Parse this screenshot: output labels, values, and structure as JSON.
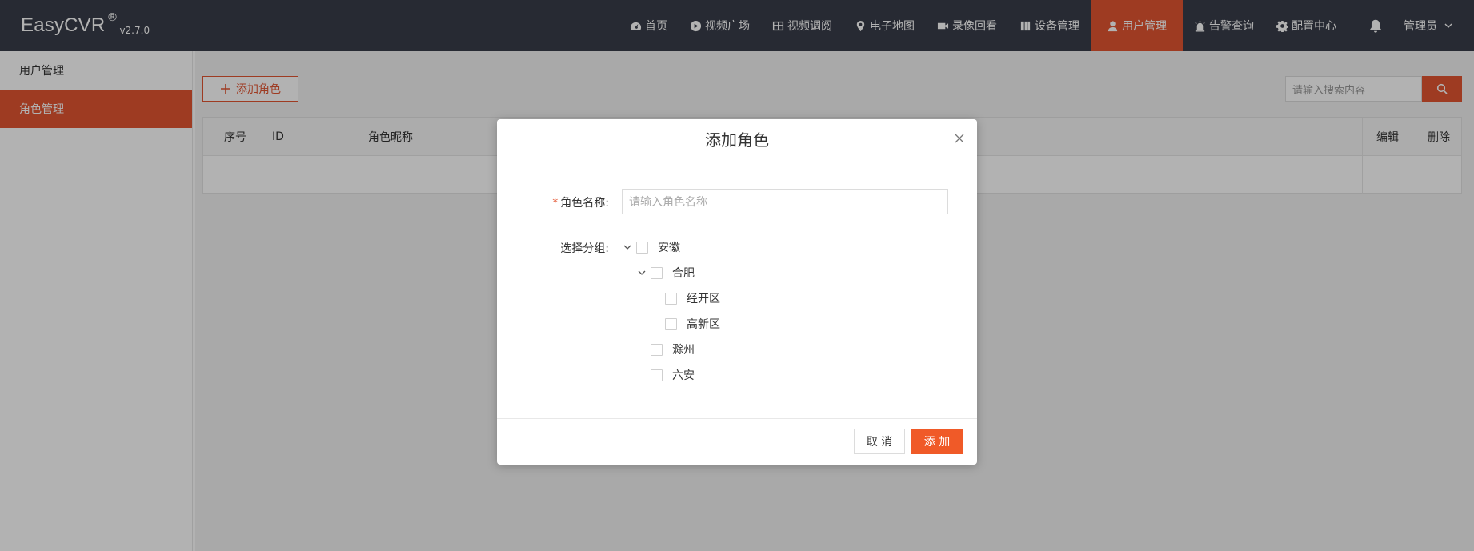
{
  "app": {
    "brand": "EasyCVR",
    "reg": "®",
    "version": "v2.7.0"
  },
  "nav": {
    "items": [
      {
        "label": "首页",
        "icon": "dashboard-icon"
      },
      {
        "label": "视频广场",
        "icon": "play-circle-icon"
      },
      {
        "label": "视频调阅",
        "icon": "grid-icon"
      },
      {
        "label": "电子地图",
        "icon": "map-pin-icon"
      },
      {
        "label": "录像回看",
        "icon": "video-camera-icon"
      },
      {
        "label": "设备管理",
        "icon": "device-icon"
      },
      {
        "label": "用户管理",
        "icon": "user-icon",
        "active": true
      },
      {
        "label": "告警查询",
        "icon": "alarm-icon"
      },
      {
        "label": "配置中心",
        "icon": "gear-icon"
      }
    ],
    "user_label": "管理员"
  },
  "sidebar": {
    "items": [
      {
        "label": "用户管理"
      },
      {
        "label": "角色管理",
        "active": true
      }
    ]
  },
  "main": {
    "add_role_label": "添加角色",
    "search_placeholder": "请输入搜索内容",
    "table": {
      "headers": [
        "序号",
        "ID",
        "角色昵称",
        "编辑",
        "删除"
      ]
    }
  },
  "modal": {
    "title": "添加角色",
    "name_label": "角色名称:",
    "required_mark": "*",
    "name_placeholder": "请输入角色名称",
    "group_label": "选择分组:",
    "tree": [
      {
        "label": "安徽",
        "level": 0,
        "expanded": true
      },
      {
        "label": "合肥",
        "level": 1,
        "expanded": true
      },
      {
        "label": "经开区",
        "level": 2
      },
      {
        "label": "高新区",
        "level": 2
      },
      {
        "label": "滁州",
        "level": 1
      },
      {
        "label": "六安",
        "level": 1
      }
    ],
    "cancel_label": "取 消",
    "add_label": "添 加"
  },
  "colors": {
    "accent": "#e35532",
    "topbar": "#393d49",
    "primary_button": "#f05a28"
  }
}
